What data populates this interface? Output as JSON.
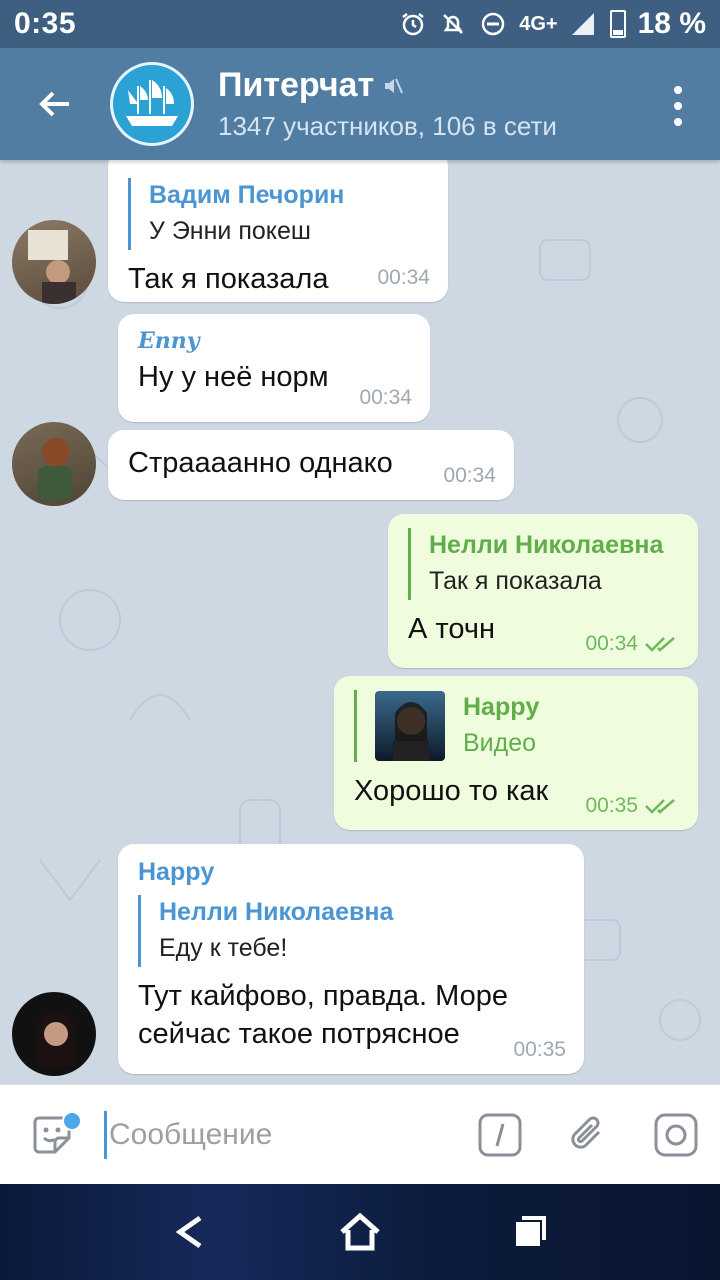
{
  "status_bar": {
    "time": "0:35",
    "network": "4G+",
    "battery": "18 %"
  },
  "header": {
    "title": "Питерчат",
    "subtitle": "1347 участников, 106 в сети"
  },
  "messages": [
    {
      "reply_name": "Вадим Печорин",
      "reply_text": "У Энни покеш",
      "text": "Так я показала",
      "time": "00:34"
    },
    {
      "sender": "Enny",
      "text": "Ну у неё норм",
      "time": "00:34"
    },
    {
      "text": "Страааанно однако",
      "time": "00:34"
    },
    {
      "reply_name": "Нелли Николаевна",
      "reply_text": "Так я показала",
      "text": "А точн",
      "time": "00:34"
    },
    {
      "reply_name": "Happy",
      "reply_text": "Видео",
      "text": "Хорошо то как",
      "time": "00:35"
    },
    {
      "sender": "Happy",
      "reply_name": "Нелли Николаевна",
      "reply_text": "Еду к тебе!",
      "text_line1": "Тут кайфово, правда. Море",
      "text_line2": "сейчас такое потрясное",
      "time": "00:35"
    }
  ],
  "input": {
    "placeholder": "Сообщение"
  },
  "icons": {
    "back": "arrow-left-icon",
    "mute": "mute-icon",
    "menu": "more-vertical-icon",
    "sticker": "sticker-icon",
    "command": "slash-command-icon",
    "attach": "paperclip-icon",
    "camera": "camera-icon",
    "nav_back": "nav-back-icon",
    "nav_home": "nav-home-icon",
    "nav_recent": "nav-recent-icon"
  },
  "colors": {
    "header": "#527da3",
    "statusbar": "#3f5f82",
    "accent": "#4a95d2",
    "outgoing": "#effdde",
    "outgoing_accent": "#5fae4a"
  }
}
